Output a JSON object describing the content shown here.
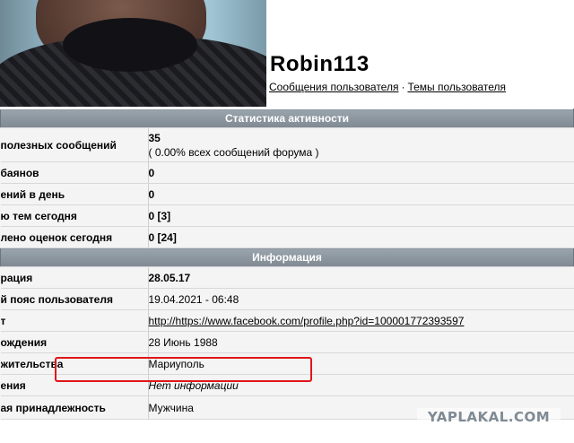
{
  "profile": {
    "username": "Robin113",
    "link_posts": "Сообщения пользователя",
    "separator": "·",
    "link_topics": "Темы пользователя"
  },
  "activity": {
    "header": "Статистика активности",
    "rows": [
      {
        "label": "полезных сообщений",
        "value": "35",
        "sub": "( 0.00% всех сообщений форума )"
      },
      {
        "label": "баянов",
        "value": "0"
      },
      {
        "label": "ений в день",
        "value": "0"
      },
      {
        "label": "ю тем сегодня",
        "value": "0 [3]"
      },
      {
        "label": "лено оценок сегодня",
        "value": "0 [24]"
      }
    ]
  },
  "info": {
    "header": "Информация",
    "rows": [
      {
        "label": "рация",
        "value": "28.05.17"
      },
      {
        "label": "й пояс пользователя",
        "value": "19.04.2021 - 06:48"
      },
      {
        "label": "т",
        "value": "http://https://www.facebook.com/profile.php?id=100001772393597"
      },
      {
        "label": "ождения",
        "value": "28 Июнь 1988"
      },
      {
        "label": "жительства",
        "value": "Мариуполь"
      },
      {
        "label": "ения",
        "value": "Нет информации"
      },
      {
        "label": "ая принадлежность",
        "value": "Мужчина"
      }
    ]
  },
  "watermark": "YAPLAKAL.COM",
  "colors": {
    "header_bg": "#8a949d",
    "highlight": "#e0141a",
    "row_bg": "#f4f4f4"
  }
}
